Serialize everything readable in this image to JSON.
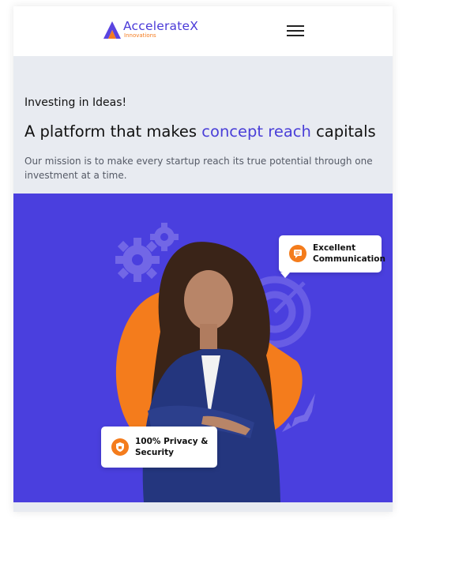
{
  "brand": {
    "name": "AccelerateX",
    "subtitle": "Innovations",
    "logo_icon": "triangle-a-logo"
  },
  "header": {
    "menu_icon": "hamburger-menu-icon"
  },
  "hero": {
    "tagline": "Investing in Ideas!",
    "headline_start": "A platform that makes ",
    "headline_highlight": "concept reach",
    "headline_end": " capitals",
    "mission": "Our mission is to make every startup reach its true potential through one investment at a time."
  },
  "cards": {
    "communication": {
      "line1": "Excellent",
      "line2": "Communication",
      "icon": "chat-bubble-icon"
    },
    "privacy": {
      "line1": "100% Privacy &",
      "line2": "Security",
      "icon": "shield-lock-icon"
    }
  },
  "colors": {
    "brand_purple": "#4a3fde",
    "accent_orange": "#f47c1c",
    "light_gray": "#e8ebf1"
  }
}
